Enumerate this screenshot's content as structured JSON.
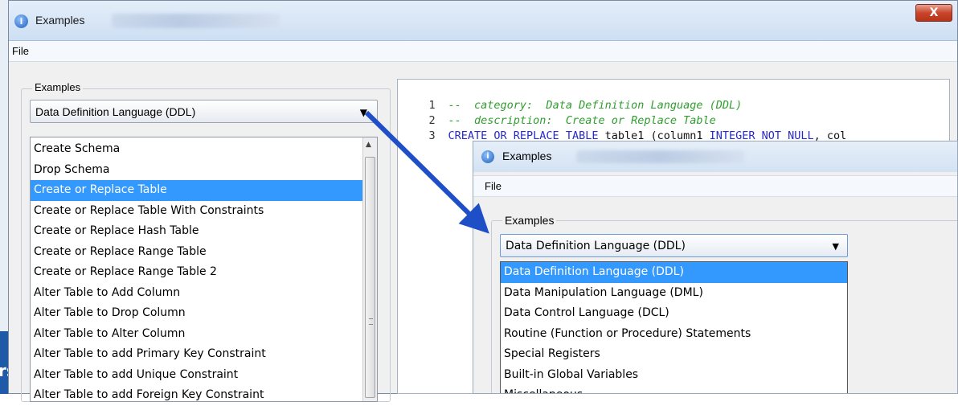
{
  "window": {
    "title": "Examples",
    "close_label": "X",
    "menu": [
      "File"
    ]
  },
  "left_panel": {
    "group_label": "Examples",
    "category_selected": "Data Definition Language (DDL)",
    "examples": [
      "Create Schema",
      "Drop Schema",
      "Create or Replace Table",
      "Create or Replace Table With Constraints",
      "Create or Replace Hash Table",
      "Create or Replace Range Table",
      "Create or Replace Range Table 2",
      "Alter Table to Add Column",
      "Alter Table to Drop Column",
      "Alter Table to Alter Column",
      "Alter Table to add Primary Key Constraint",
      "Alter Table to add Unique Constraint",
      "Alter Table to add Foreign Key Constraint"
    ],
    "selected_index": 2
  },
  "editor": {
    "lines": [
      {
        "num": "1",
        "prefix": "--  ",
        "text": "category:  Data Definition Language (DDL)"
      },
      {
        "num": "2",
        "prefix": "--  ",
        "text": "description:  Create or Replace Table"
      },
      {
        "num": "3",
        "kw1": "CREATE OR REPLACE TABLE",
        "plain1": " table1 (column1 ",
        "kw2": "INTEGER NOT NULL",
        "plain2": ", col"
      }
    ]
  },
  "inset": {
    "title": "Examples",
    "menu_file": "File",
    "group_label": "Examples",
    "combo_value": "Data Definition Language (DDL)",
    "options": [
      "Data Definition Language (DDL)",
      "Data Manipulation Language (DML)",
      "Data Control Language (DCL)",
      "Routine (Function or Procedure) Statements",
      "Special Registers",
      "Built-in Global Variables",
      "Miscellaneous"
    ],
    "selected_index": 0
  },
  "background_fragment": {
    "text": "rs"
  },
  "colors": {
    "selection": "#3399ff",
    "comment": "#2f9e2f",
    "keyword": "#2a2ad0",
    "arrow": "#1f4fc7"
  }
}
